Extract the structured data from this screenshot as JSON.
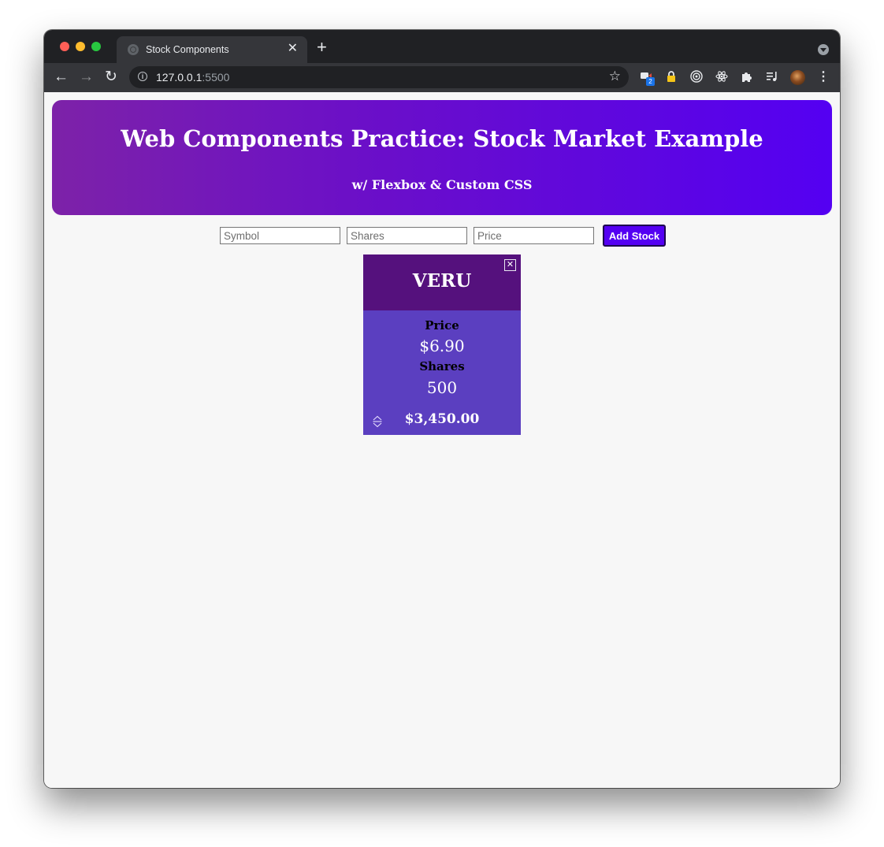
{
  "browser": {
    "tab_title": "Stock Components",
    "tab_close": "✕",
    "new_tab": "+",
    "url_host": "127.0.0.1",
    "url_port": ":5500",
    "extension_badge": "2"
  },
  "page": {
    "title": "Web Components Practice: Stock Market Example",
    "subtitle": "w/ Flexbox & Custom CSS"
  },
  "form": {
    "symbol_placeholder": "Symbol",
    "shares_placeholder": "Shares",
    "price_placeholder": "Price",
    "add_button": "Add Stock"
  },
  "stocks": [
    {
      "symbol": "VERU",
      "price_label": "Price",
      "price": "$6.90",
      "shares_label": "Shares",
      "shares": "500",
      "total": "$3,450.00",
      "close": "✕"
    }
  ],
  "colors": {
    "header_gradient_start": "#7d22a8",
    "header_gradient_end": "#5400f2",
    "card_top": "#55117d",
    "card_body": "#5b3fc0",
    "button": "#5400f2"
  }
}
